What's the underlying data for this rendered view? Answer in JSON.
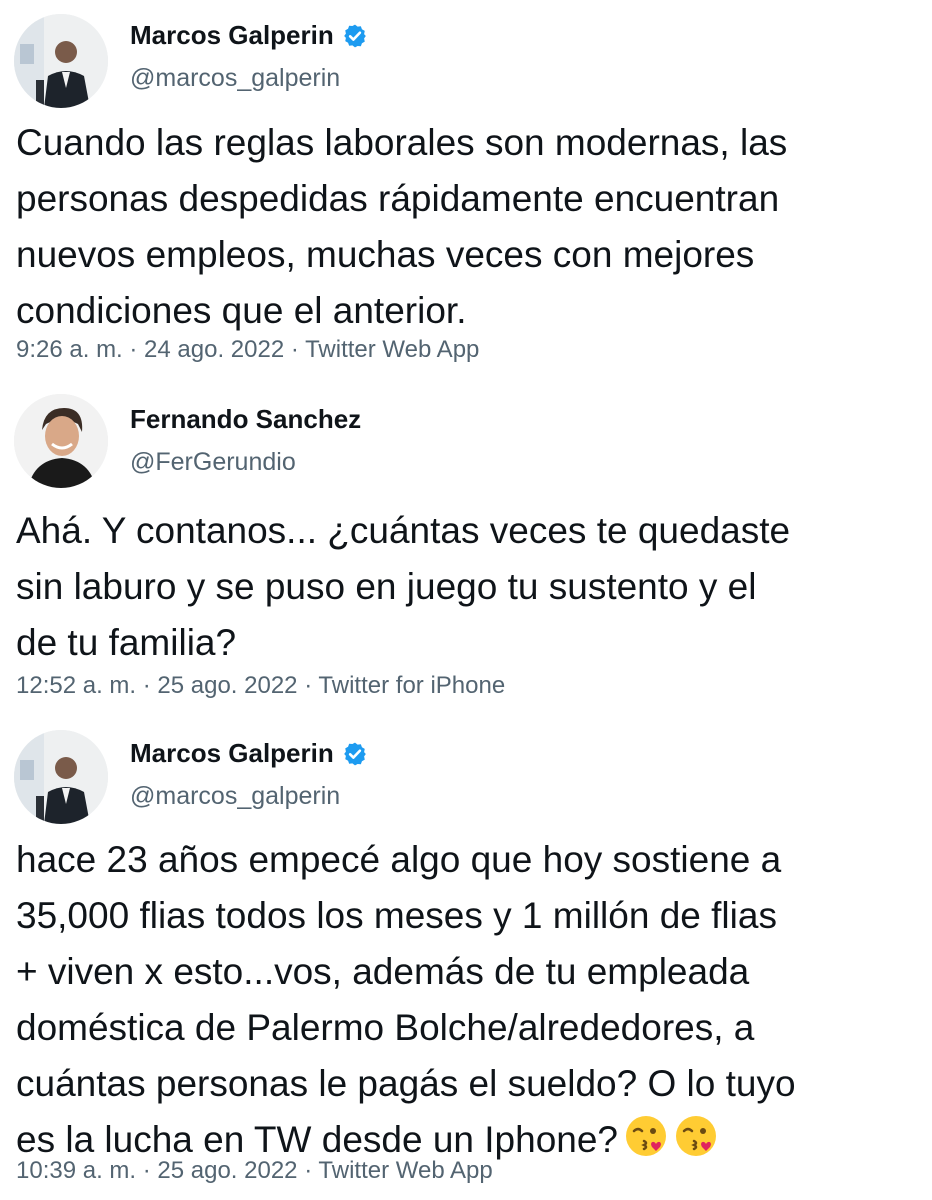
{
  "tweets": [
    {
      "author_name": "Marcos Galperin",
      "handle": "@marcos_galperin",
      "verified": true,
      "avatar_icon": "profile-photo-man-suit",
      "text": "Cuando las reglas laborales son modernas, las\npersonas despedidas rápidamente encuentran\nnuevos empleos, muchas veces con mejores\ncondiciones que el anterior.",
      "meta": "9:26 a. m. · 24 ago. 2022 · Twitter Web App"
    },
    {
      "author_name": "Fernando Sanchez",
      "handle": "@FerGerundio",
      "verified": false,
      "avatar_icon": "profile-photo-man-smiling",
      "text": "Ahá. Y contanos... ¿cuántas veces te quedaste\nsin laburo y se puso en juego tu sustento y el\nde tu familia?",
      "meta": "12:52 a. m. · 25 ago. 2022 · Twitter for iPhone"
    },
    {
      "author_name": "Marcos Galperin",
      "handle": "@marcos_galperin",
      "verified": true,
      "avatar_icon": "profile-photo-man-suit",
      "text": "hace 23 años empecé algo que hoy sostiene a\n35,000 flias todos los meses y 1 millón de flias\n+ viven x esto...vos, además de tu empleada\ndoméstica de Palermo Bolche/alrededores, a\ncuántas personas le pagás el sueldo? O lo tuyo\nes la lucha en TW desde un Iphone?",
      "emojis": [
        "face-blowing-kiss-emoji",
        "face-blowing-kiss-emoji"
      ],
      "meta": "10:39 a. m. · 25 ago. 2022 · Twitter Web App"
    }
  ],
  "colors": {
    "text": "#0f1419",
    "secondary": "#536471",
    "verified": "#1d9bf0",
    "emoji_face": "#ffcc33",
    "emoji_heart": "#e0245e"
  }
}
